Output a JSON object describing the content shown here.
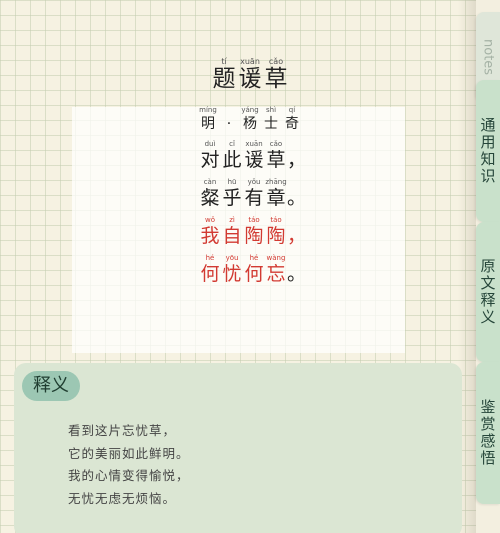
{
  "poem": {
    "title": [
      {
        "py": "tí",
        "hz": "题"
      },
      {
        "py": "xuān",
        "hz": "谖"
      },
      {
        "py": "cǎo",
        "hz": "草"
      }
    ],
    "author": [
      {
        "py": "míng",
        "hz": "明"
      },
      {
        "py": "",
        "hz": "·"
      },
      {
        "py": "yáng",
        "hz": "杨"
      },
      {
        "py": "shì",
        "hz": "士"
      },
      {
        "py": "qí",
        "hz": "奇"
      }
    ],
    "line1": [
      {
        "py": "duì",
        "hz": "对"
      },
      {
        "py": "cǐ",
        "hz": "此"
      },
      {
        "py": "xuān",
        "hz": "谖"
      },
      {
        "py": "cǎo",
        "hz": "草"
      }
    ],
    "line1_punc": "，",
    "line2": [
      {
        "py": "càn",
        "hz": "粲"
      },
      {
        "py": "hū",
        "hz": "乎"
      },
      {
        "py": "yǒu",
        "hz": "有"
      },
      {
        "py": "zhāng",
        "hz": "章"
      }
    ],
    "line2_punc": "。",
    "line3": [
      {
        "py": "wǒ",
        "hz": "我"
      },
      {
        "py": "zì",
        "hz": "自"
      },
      {
        "py": "táo",
        "hz": "陶"
      },
      {
        "py": "táo",
        "hz": "陶"
      }
    ],
    "line3_punc": "，",
    "line4": [
      {
        "py": "hé",
        "hz": "何"
      },
      {
        "py": "yōu",
        "hz": "忧"
      },
      {
        "py": "hé",
        "hz": "何"
      },
      {
        "py": "wàng",
        "hz": "忘"
      }
    ],
    "line4_punc": "。"
  },
  "meaning": {
    "tag": "释义",
    "lines": [
      "看到这片忘忧草，",
      "它的美丽如此鲜明。",
      "我的心情变得愉悦，",
      "无忧无虑无烦恼。"
    ]
  },
  "tabs": {
    "notes": "notes",
    "tab1": "通用知识",
    "tab2": "原文释义",
    "tab3": "鉴赏感悟"
  },
  "colors": {
    "highlight": "#d23a32",
    "panel": "#dbe6d3",
    "tag": "#9cc7b3",
    "tab": "#c9e1cb"
  }
}
